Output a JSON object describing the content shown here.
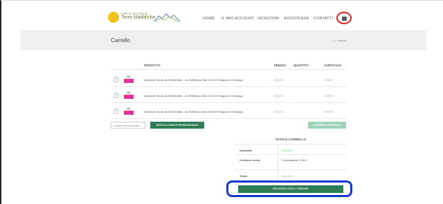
{
  "header": {
    "logo_line1": "PARCO NATURALE",
    "logo_line2": "Terre Matildiche",
    "nav": [
      "HOME",
      "IL MIO ACCOUNT",
      "ISCRIZIONI",
      "ASSISTENZA",
      "CONTATTI"
    ],
    "cart_icon": "cart-icon",
    "highlight_color": "#e01b1b"
  },
  "page": {
    "title": "Carrello",
    "breadcrumb": "⌂ › Carrello"
  },
  "cart": {
    "columns": [
      "PRODOTTO",
      "PREZZO",
      "QUANTITÀ",
      "SUBTOTALE"
    ],
    "items": [
      {
        "name": "Iscrizione 3a-4a-5a Elementare - 1a Settimana (Dal 12 Al 16 Giugno) A Gonzaga",
        "price": "35,00 €",
        "subtotal": "35,00 €"
      },
      {
        "name": "Iscrizione 3a-4a-5a Elementare - 2a Settimana (Dal 19 Al 23 Giugno) A Gonzaga",
        "price": "35,00 €",
        "subtotal": "35,00 €"
      },
      {
        "name": "Iscrizione 3a-4a-5a Elementare - 3a Settimana (Dal 26 Al 30 Giugno) A Gonzaga",
        "price": "35,00 €",
        "subtotal": "35,00 €"
      }
    ],
    "coupon_placeholder": "Codice promozionale",
    "coupon_button": "APPLICA CODICE PROMOZIONALE",
    "update_button": "AGGIORNA CARRELLO"
  },
  "totals": {
    "title": "TOTALE CARRELLO",
    "subtotal_label": "Subtotale",
    "subtotal_value": "105,00 €",
    "fee_label": "Gestione ordine",
    "fee_value": "Commissioni: 4,00 €",
    "total_label": "Totale",
    "total_value": "109,00 €",
    "checkout_button": "PROCEDI CON L'ORDINE",
    "highlight_color": "#1238c8"
  },
  "colors": {
    "accent": "#2e7d57",
    "price": "#6fbf6a",
    "product_thumb": "#e2358b"
  }
}
